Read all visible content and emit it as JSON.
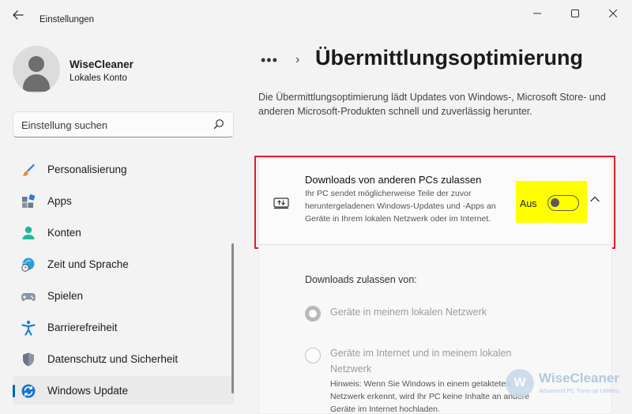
{
  "window": {
    "title": "Einstellungen",
    "controls": {
      "minimize": "—",
      "maximize": "☐",
      "close": "✕"
    }
  },
  "profile": {
    "name": "WiseCleaner",
    "account": "Lokales Konto"
  },
  "search": {
    "placeholder": "Einstellung suchen"
  },
  "sidebar": {
    "items": [
      {
        "label": "Personalisierung",
        "icon": "brush-icon"
      },
      {
        "label": "Apps",
        "icon": "apps-icon"
      },
      {
        "label": "Konten",
        "icon": "account-icon"
      },
      {
        "label": "Zeit und Sprache",
        "icon": "globe-clock-icon"
      },
      {
        "label": "Spielen",
        "icon": "gamepad-icon"
      },
      {
        "label": "Barrierefreiheit",
        "icon": "accessibility-icon"
      },
      {
        "label": "Datenschutz und Sicherheit",
        "icon": "shield-icon"
      },
      {
        "label": "Windows Update",
        "icon": "windows-update-icon",
        "active": true
      }
    ]
  },
  "breadcrumb": {
    "more": "•••",
    "separator": "›",
    "title": "Übermittlungsoptimierung"
  },
  "description": "Die Übermittlungsoptimierung lädt Updates von Windows-, Microsoft Store- und anderen Microsoft-Produkten schnell und zuverlässig herunter.",
  "setting": {
    "title": "Downloads von anderen PCs zulassen",
    "description": "Ihr PC sendet möglicherweise Teile der zuvor heruntergeladenen Windows-Updates und -Apps an Geräte in Ihrem lokalen Netzwerk oder im Internet.",
    "toggle_label": "Aus",
    "toggle_on": false,
    "highlight_color": "#ffff00",
    "outline_color": "#e01e2a"
  },
  "allow_from": {
    "heading": "Downloads zulassen von:",
    "options": [
      {
        "label": "Geräte in meinem lokalen Netzwerk",
        "checked": true
      },
      {
        "label": "Geräte im Internet und in meinem lokalen Netzwerk",
        "checked": false,
        "note": "Hinweis: Wenn Sie Windows in einem getakteten Netzwerk erkennt, wird Ihr PC keine Inhalte an andere Geräte im Internet hochladen."
      }
    ]
  },
  "watermark": {
    "brand": "WiseCleaner",
    "tagline": "Advanced PC Tune-up Utilities",
    "logo_letter": "W"
  }
}
